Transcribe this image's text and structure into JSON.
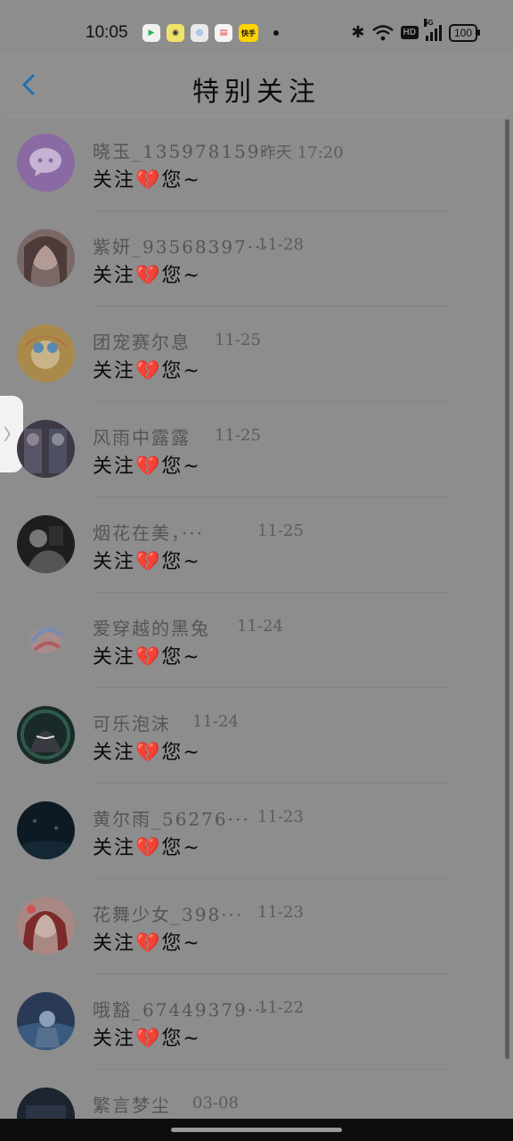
{
  "status_bar": {
    "time": "10:05",
    "apps": [
      {
        "icon": "video-app-icon",
        "glyph": "▶"
      },
      {
        "icon": "chat-app-icon",
        "glyph": "◉"
      },
      {
        "icon": "browser-app-icon",
        "glyph": "◎"
      },
      {
        "icon": "store-app-icon",
        "glyph": "▤"
      },
      {
        "icon": "kuaishou-app-icon",
        "glyph": "快手"
      }
    ],
    "hd_label": "HD",
    "network_label": "5G",
    "battery": "100"
  },
  "header": {
    "back_glyph": "‹",
    "title": "特别关注"
  },
  "side_handle_glyph": "〉",
  "items": [
    {
      "name": "晓玉_135978159···",
      "time": "昨天 17:20",
      "message": "关注💔您~"
    },
    {
      "name": "紫妍_93568397···",
      "time": "11-28",
      "message": "关注💔您~"
    },
    {
      "name": "团宠赛尔息",
      "time": "11-25",
      "message": "关注💔您~"
    },
    {
      "name": "风雨中露露",
      "time": "11-25",
      "message": "关注💔您~"
    },
    {
      "name": "烟花在美，···",
      "time": "11-25",
      "message": "关注💔您~"
    },
    {
      "name": "爱穿越的黑兔",
      "time": "11-24",
      "message": "关注💔您~"
    },
    {
      "name": "可乐泡沫",
      "time": "11-24",
      "message": "关注💔您~"
    },
    {
      "name": "黄尔雨_56276···",
      "time": "11-23",
      "message": "关注💔您~"
    },
    {
      "name": "花舞少女_398···",
      "time": "11-23",
      "message": "关注💔您~"
    },
    {
      "name": "哦豁_67449379···",
      "time": "11-22",
      "message": "关注💔您~"
    },
    {
      "name": "繁言梦尘",
      "time": "03-08",
      "message": ""
    }
  ],
  "colors": {
    "overlay_bg": "#8d8d8d",
    "back_accent": "#1f6fb0",
    "name_text": "#555555",
    "message_text": "#0a0a0a"
  }
}
